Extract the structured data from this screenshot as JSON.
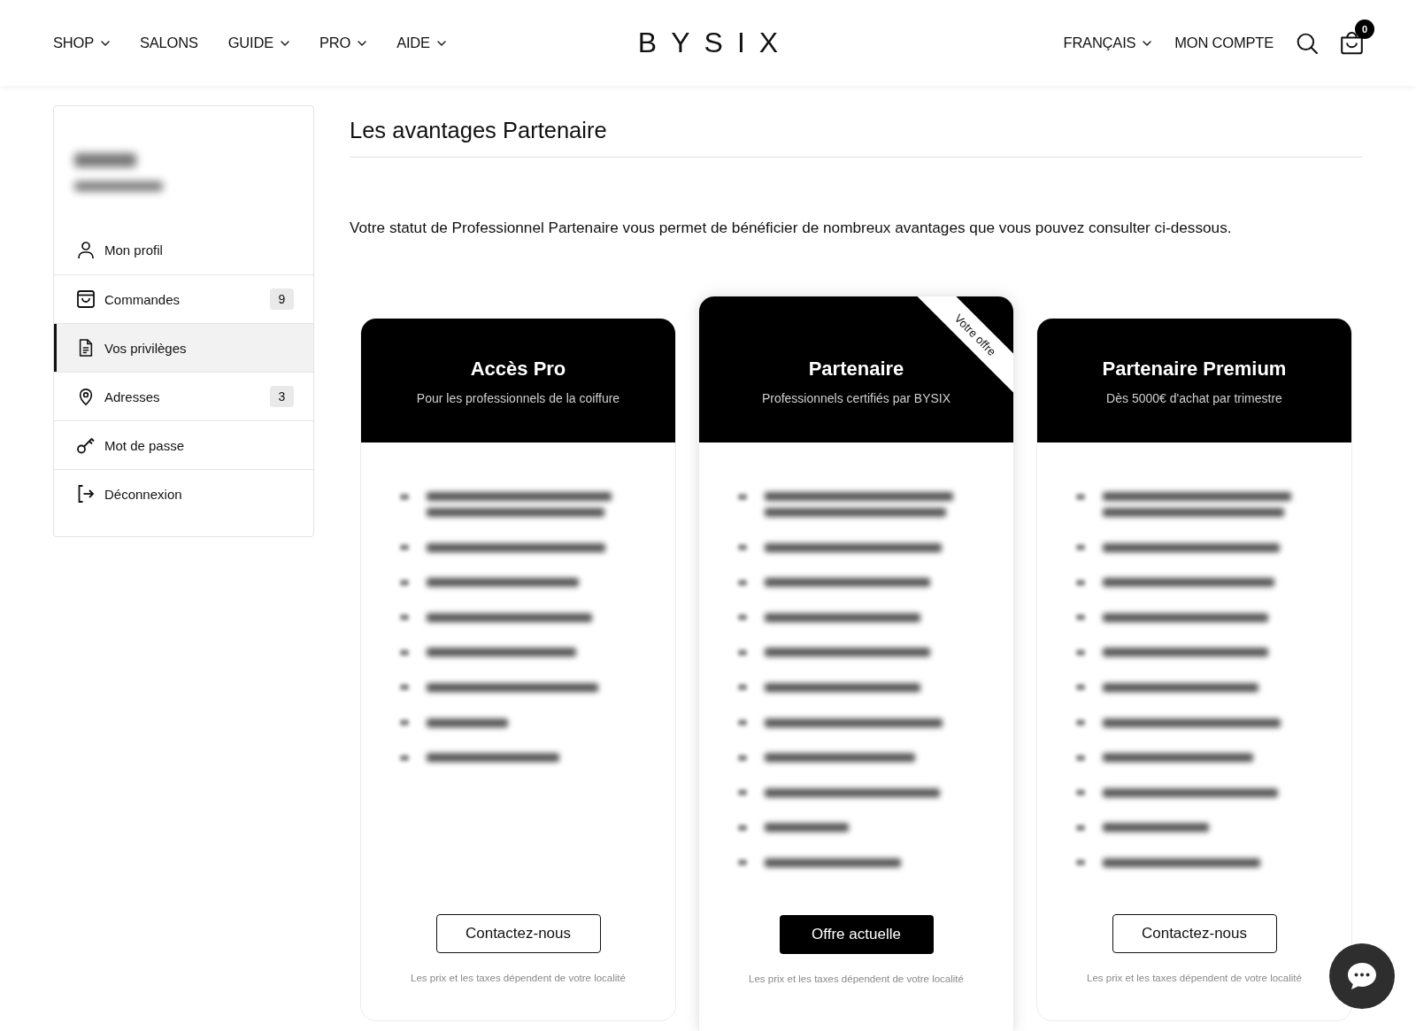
{
  "header": {
    "nav": [
      {
        "label": "SHOP",
        "dropdown": true
      },
      {
        "label": "SALONS",
        "dropdown": false
      },
      {
        "label": "GUIDE",
        "dropdown": true
      },
      {
        "label": "PRO",
        "dropdown": true
      },
      {
        "label": "AIDE",
        "dropdown": true
      }
    ],
    "logo": "BYSIX",
    "language": {
      "label": "FRANÇAIS",
      "dropdown": true
    },
    "account_link": "MON COMPTE",
    "cart_count": "0"
  },
  "sidebar": {
    "profile_blurred": true,
    "items": [
      {
        "label": "Mon profil",
        "selected": false
      },
      {
        "label": "Commandes",
        "count": "9",
        "selected": false
      },
      {
        "label": "Vos privilèges",
        "selected": true
      },
      {
        "label": "Adresses",
        "count": "3",
        "selected": false
      },
      {
        "label": "Mot de passe",
        "selected": false
      },
      {
        "label": "Déconnexion",
        "selected": false
      }
    ]
  },
  "main": {
    "title": "Les avantages Partenaire",
    "intro": "Votre statut de Professionnel Partenaire vous permet de bénéficier de nombreux avantages que vous pouvez consulter ci-dessous.",
    "plans": [
      {
        "title": "Accès Pro",
        "subtitle": "Pour les professionnels de la coiffure",
        "selected": false,
        "features": [
          {
            "kind": "blurred-two-line"
          },
          {
            "kind": "blurred"
          },
          {
            "kind": "blurred"
          },
          {
            "kind": "blurred"
          },
          {
            "kind": "blurred"
          },
          {
            "kind": "blurred"
          },
          {
            "kind": "blurred"
          },
          {
            "kind": "blurred"
          }
        ],
        "button": "Contactez-nous",
        "note": "Les prix et les taxes dépendent de votre localité"
      },
      {
        "title": "Partenaire",
        "subtitle": "Professionnels certifiés par BYSIX",
        "selected": true,
        "ribbon": "Votre offre",
        "features": [
          {
            "kind": "blurred-two-line"
          },
          {
            "kind": "blurred"
          },
          {
            "kind": "blurred"
          },
          {
            "kind": "blurred"
          },
          {
            "kind": "blurred"
          },
          {
            "kind": "blurred"
          },
          {
            "kind": "blurred"
          },
          {
            "kind": "blurred"
          },
          {
            "kind": "blurred"
          },
          {
            "kind": "blurred"
          },
          {
            "kind": "blurred"
          }
        ],
        "button": "Offre actuelle",
        "note": "Les prix et les taxes dépendent de votre localité"
      },
      {
        "title": "Partenaire Premium",
        "subtitle": "Dès 5000€ d'achat par trimestre",
        "selected": false,
        "features": [
          {
            "kind": "blurred-two-line"
          },
          {
            "kind": "blurred"
          },
          {
            "kind": "blurred"
          },
          {
            "kind": "blurred"
          },
          {
            "kind": "blurred"
          },
          {
            "kind": "blurred"
          },
          {
            "kind": "blurred"
          },
          {
            "kind": "blurred"
          },
          {
            "kind": "blurred"
          },
          {
            "kind": "blurred"
          },
          {
            "kind": "blurred"
          }
        ],
        "button": "Contactez-nous",
        "note": "Les prix et les taxes dépendent de votre localité"
      }
    ]
  }
}
